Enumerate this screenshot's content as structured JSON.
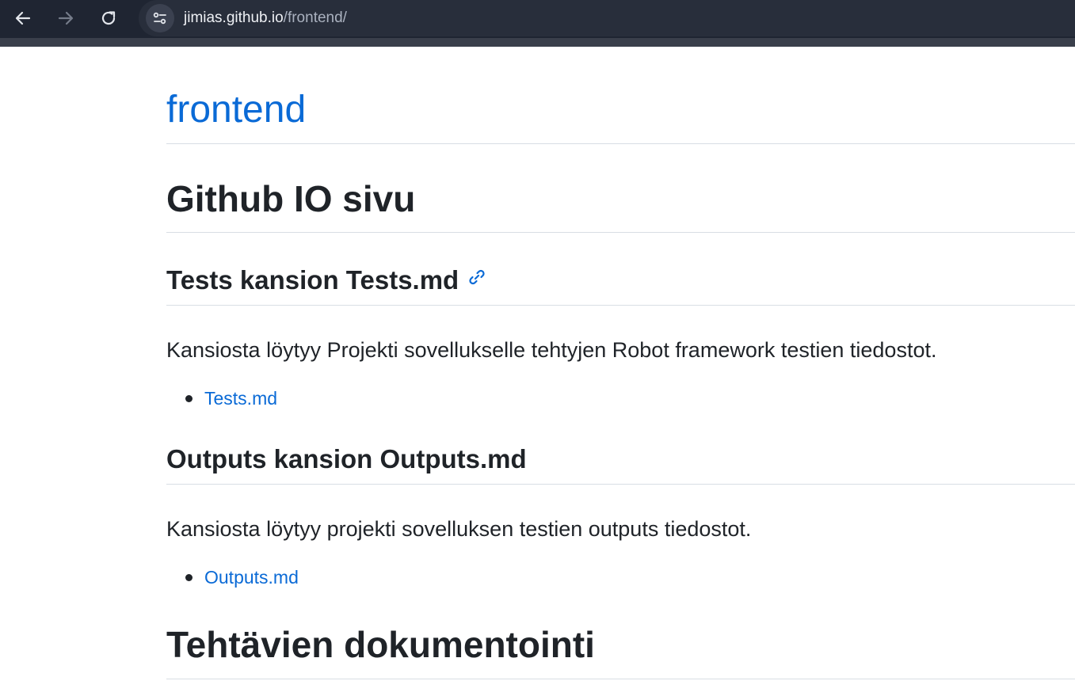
{
  "browser": {
    "url_host": "jimias.github.io",
    "url_path": "/frontend/",
    "icons": [
      "back-arrow-icon",
      "forward-arrow-icon",
      "reload-icon",
      "site-settings-icon"
    ]
  },
  "page": {
    "site_title": "frontend",
    "heading_main": "Github IO sivu",
    "section_tests": {
      "heading": "Tests kansion Tests.md",
      "description": "Kansiosta löytyy Projekti sovellukselle tehtyjen Robot framework testien tiedostot.",
      "links": [
        "Tests.md"
      ]
    },
    "section_outputs": {
      "heading": "Outputs kansion Outputs.md",
      "description": "Kansiosta löytyy projekti sovelluksen testien outputs tiedostot.",
      "links": [
        "Outputs.md"
      ]
    },
    "heading_docs": "Tehtävien dokumentointi"
  },
  "colors": {
    "link": "#0a6ad6",
    "text": "#1f2328",
    "browser_bar": "#1f2532",
    "divider": "#d8dee4"
  }
}
